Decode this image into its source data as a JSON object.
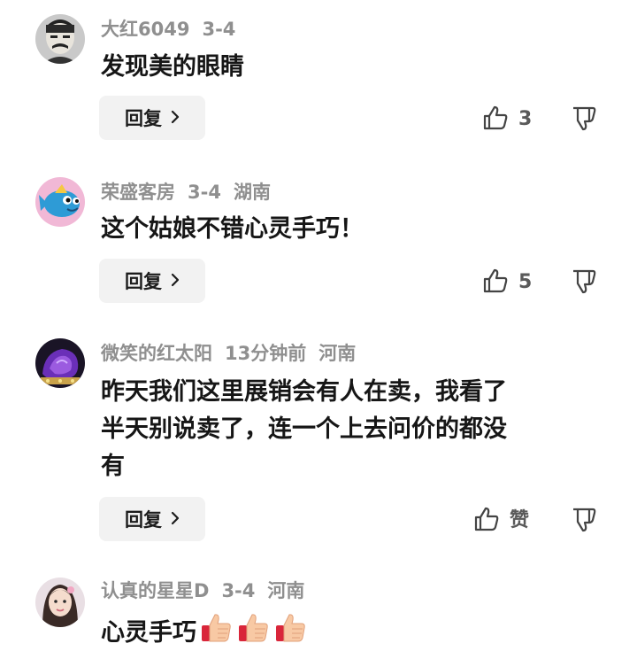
{
  "comments": [
    {
      "username": "大红6049",
      "date": "3-4",
      "location": "",
      "text_lines": [
        "发现美的眼睛"
      ],
      "reply_label": "回复",
      "like_count": "3",
      "avatar": "portrait-sketch"
    },
    {
      "username": "荣盛客房",
      "date": "3-4",
      "location": "湖南",
      "text_lines": [
        "这个姑娘不错心灵手巧！"
      ],
      "reply_label": "回复",
      "like_count": "5",
      "avatar": "cartoon-fish"
    },
    {
      "username": "微笑的红太阳",
      "date": "13分钟前",
      "location": "河南",
      "text_lines": [
        "昨天我们这里展销会有人在卖，我看了",
        "半天别说卖了，连一个上去问价的都没",
        "有"
      ],
      "reply_label": "回复",
      "like_count": "赞",
      "avatar": "purple-crystal"
    },
    {
      "username": "认真的星星D",
      "date": "3-4",
      "location": "河南",
      "text_lines": [
        "心灵手巧"
      ],
      "emojis": [
        "thumbs-up-emoji",
        "thumbs-up-emoji",
        "thumbs-up-emoji"
      ],
      "avatar": "girl-photo"
    }
  ],
  "icons": {
    "like": "thumbs-up-outline-icon",
    "dislike": "thumbs-down-outline-icon",
    "reply_chevron": "chevron-right-icon"
  }
}
